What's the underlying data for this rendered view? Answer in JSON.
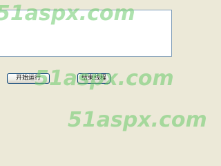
{
  "buttons": {
    "start_label": "开始运行",
    "stop_label": "结束线程"
  },
  "watermark": {
    "text": "51aspx.com"
  },
  "output": {
    "text": ""
  },
  "colors": {
    "background": "#ece9d8",
    "watermark": "#6ccb6c",
    "button_border": "#003c74"
  }
}
